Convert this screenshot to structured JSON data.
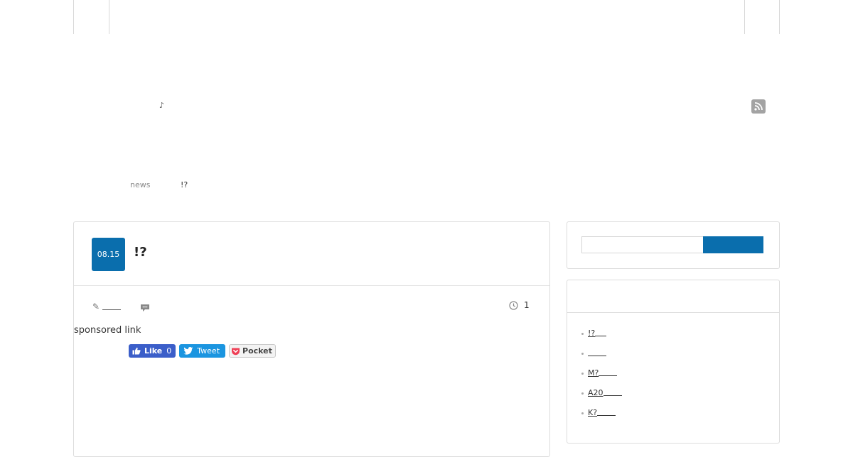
{
  "header": {
    "note": "♪",
    "rss_icon": "rss-icon"
  },
  "breadcrumb": {
    "category": "news",
    "current": "!?"
  },
  "post": {
    "date": "08.15",
    "title": "!?",
    "views": "1",
    "sponsored": "sponsored link",
    "share": {
      "like_label": "Like",
      "like_count": "0",
      "tweet_label": "Tweet",
      "pocket_label": "Pocket"
    }
  },
  "sidebar": {
    "search": {
      "placeholder": ""
    },
    "list": [
      {
        "label": "!?"
      },
      {
        "label": ""
      },
      {
        "label": "M?"
      },
      {
        "label": "A20"
      },
      {
        "label": "K?"
      }
    ]
  },
  "colors": {
    "accent": "#0a6ead",
    "facebook": "#3b5ec9",
    "twitter": "#1b95e0",
    "pocket": "#ef4056"
  }
}
